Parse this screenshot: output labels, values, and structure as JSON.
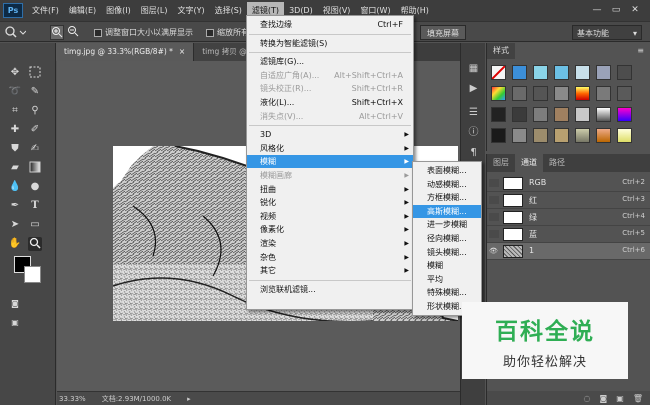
{
  "app": {
    "logo": "Ps"
  },
  "menubar": {
    "items": [
      "文件(F)",
      "编辑(E)",
      "图像(I)",
      "图层(L)",
      "文字(Y)",
      "选择(S)",
      "滤镜(T)",
      "3D(D)",
      "视图(V)",
      "窗口(W)",
      "帮助(H)"
    ],
    "active_index": 6
  },
  "window_controls": {
    "minimize": "—",
    "restore": "▭",
    "close": "✕"
  },
  "options_bar": {
    "tool_icon": "zoom-icon",
    "resize_windows_label": "调整窗口大小以满屏显示",
    "zoom_all_label": "缩放所有",
    "fill_screen_button": "填充屏幕",
    "workspace": "基本功能"
  },
  "doc_tabs": [
    {
      "label": "timg.jpg @ 33.3%(RGB/8#) *",
      "close": "×",
      "active": true
    },
    {
      "label": "timg 拷贝 @ 33.3",
      "close": "×",
      "active": false
    }
  ],
  "status": {
    "zoom": "33.33%",
    "doc_info": "文档:2.93M/1000.0K"
  },
  "filter_menu": {
    "items": [
      {
        "label": "查找边缘",
        "shortcut": "Ctrl+F",
        "state": "normal"
      },
      {
        "sep": true
      },
      {
        "label": "转换为智能滤镜(S)",
        "state": "normal"
      },
      {
        "sep": true
      },
      {
        "label": "滤镜库(G)...",
        "state": "normal"
      },
      {
        "label": "自适应广角(A)...",
        "shortcut": "Alt+Shift+Ctrl+A",
        "state": "disabled"
      },
      {
        "label": "镜头校正(R)...",
        "shortcut": "Shift+Ctrl+R",
        "state": "disabled"
      },
      {
        "label": "液化(L)...",
        "shortcut": "Shift+Ctrl+X",
        "state": "normal"
      },
      {
        "label": "消失点(V)...",
        "shortcut": "Alt+Ctrl+V",
        "state": "disabled"
      },
      {
        "sep": true
      },
      {
        "label": "3D",
        "submenu": true,
        "state": "normal"
      },
      {
        "label": "风格化",
        "submenu": true,
        "state": "normal"
      },
      {
        "label": "模糊",
        "submenu": true,
        "state": "highlighted"
      },
      {
        "label": "模糊画廊",
        "submenu": true,
        "state": "disabled"
      },
      {
        "label": "扭曲",
        "submenu": true,
        "state": "normal"
      },
      {
        "label": "锐化",
        "submenu": true,
        "state": "normal"
      },
      {
        "label": "视频",
        "submenu": true,
        "state": "normal"
      },
      {
        "label": "像素化",
        "submenu": true,
        "state": "normal"
      },
      {
        "label": "渲染",
        "submenu": true,
        "state": "normal"
      },
      {
        "label": "杂色",
        "submenu": true,
        "state": "normal"
      },
      {
        "label": "其它",
        "submenu": true,
        "state": "normal"
      },
      {
        "sep": true
      },
      {
        "label": "浏览联机滤镜...",
        "state": "normal"
      }
    ]
  },
  "blur_submenu": {
    "items": [
      {
        "label": "表面模糊...",
        "state": "normal"
      },
      {
        "label": "动感模糊...",
        "state": "normal"
      },
      {
        "label": "方框模糊...",
        "state": "normal"
      },
      {
        "label": "高斯模糊...",
        "state": "highlighted"
      },
      {
        "label": "进一步模糊",
        "state": "normal"
      },
      {
        "label": "径向模糊...",
        "state": "normal"
      },
      {
        "label": "镜头模糊...",
        "state": "normal"
      },
      {
        "label": "模糊",
        "state": "normal"
      },
      {
        "label": "平均",
        "state": "normal"
      },
      {
        "label": "特殊模糊...",
        "state": "normal"
      },
      {
        "label": "形状模糊...",
        "state": "normal"
      }
    ]
  },
  "styles_panel": {
    "tab": "样式"
  },
  "layers_panel": {
    "tabs": [
      "图层",
      "通道",
      "路径"
    ],
    "active_tab": 1,
    "channels": [
      {
        "name": "RGB",
        "shortcut": "Ctrl+2",
        "visible": false,
        "selected": false
      },
      {
        "name": "红",
        "shortcut": "Ctrl+3",
        "visible": false,
        "selected": false
      },
      {
        "name": "绿",
        "shortcut": "Ctrl+4",
        "visible": false,
        "selected": false
      },
      {
        "name": "蓝",
        "shortcut": "Ctrl+5",
        "visible": false,
        "selected": false
      },
      {
        "name": "1",
        "shortcut": "Ctrl+6",
        "visible": true,
        "selected": true
      }
    ]
  },
  "watermark": {
    "title": "百科全说",
    "subtitle": "助你轻松解决"
  },
  "colors": {
    "menu_highlight": "#3596e5",
    "ui_dark": "#3d3d3d",
    "canvas_bg": "#5b5b5b",
    "watermark_green": "#2fae54"
  }
}
